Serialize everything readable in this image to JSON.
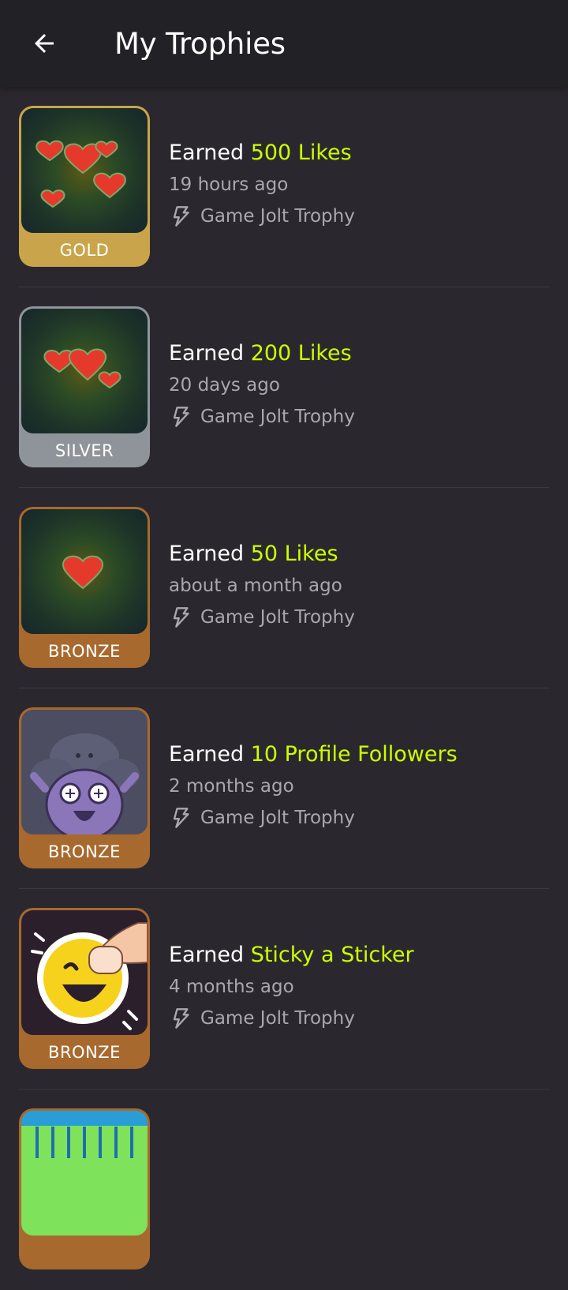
{
  "header": {
    "title": "My Trophies",
    "back_icon": "arrow-left-icon"
  },
  "colors": {
    "background": "#2a282e",
    "header": "#222125",
    "accent": "#ccff00",
    "muted": "#a9a8ad",
    "gold": "#c9a44a",
    "silver": "#8f949a",
    "bronze": "#a8692e"
  },
  "trophies": [
    {
      "prefix": "Earned",
      "name": "500 Likes",
      "time": "19 hours ago",
      "source": "Game Jolt Trophy",
      "tier": "GOLD",
      "art": "hearts-cluster-icon"
    },
    {
      "prefix": "Earned",
      "name": "200 Likes",
      "time": "20 days ago",
      "source": "Game Jolt Trophy",
      "tier": "SILVER",
      "art": "hearts-pair-icon"
    },
    {
      "prefix": "Earned",
      "name": "50 Likes",
      "time": "about a month ago",
      "source": "Game Jolt Trophy",
      "tier": "BRONZE",
      "art": "heart-icon"
    },
    {
      "prefix": "Earned",
      "name": "10 Profile Followers",
      "time": "2 months ago",
      "source": "Game Jolt Trophy",
      "tier": "BRONZE",
      "art": "followers-blob-icon"
    },
    {
      "prefix": "Earned",
      "name": "Sticky a Sticker",
      "time": "4 months ago",
      "source": "Game Jolt Trophy",
      "tier": "BRONZE",
      "art": "sticker-emoji-icon"
    }
  ]
}
